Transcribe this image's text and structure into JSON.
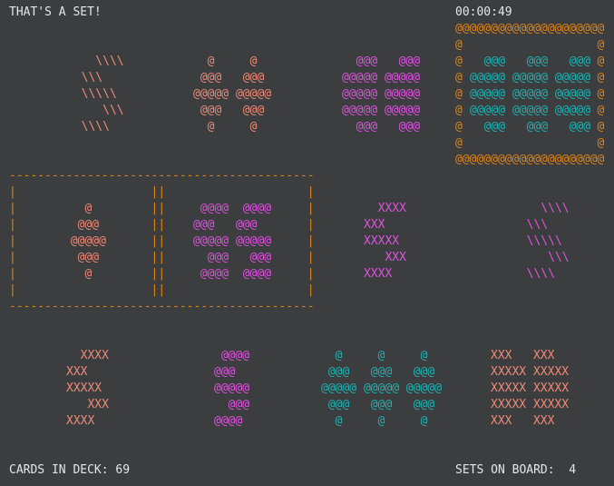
{
  "header": {
    "title": "THAT'S A SET!",
    "timer": "00:00:49"
  },
  "footer": {
    "deck_label": "CARDS IN DECK: 69",
    "sets_label": "SETS ON BOARD:  4"
  },
  "colors": {
    "salmon": "#f08a78",
    "magenta": "#e052e0",
    "teal": "#1fb3b3",
    "orange": "#e0851a",
    "background": "#3b3d3f",
    "text": "#e6e6e6"
  },
  "cards": [
    {
      "id": "r1c1",
      "color": "salmon",
      "art": "    \\\\\\\\\n  \\\\\\\n  \\\\\\\\\\\n     \\\\\\\n  \\\\\\\\"
    },
    {
      "id": "r1c2",
      "color": "salmon",
      "art": "  @     @\n @@@   @@@\n@@@@@ @@@@@\n @@@   @@@\n  @     @"
    },
    {
      "id": "r1c3",
      "color": "magenta",
      "art": "  @@@   @@@\n@@@@@ @@@@@\n@@@@@ @@@@@\n@@@@@ @@@@@\n  @@@   @@@"
    },
    {
      "id": "r1c4",
      "color": "teal",
      "art": "  @@@   @@@   @@@\n@@@@@ @@@@@ @@@@@\n@@@@@ @@@@@ @@@@@\n@@@@@ @@@@@ @@@@@\n  @@@   @@@   @@@"
    },
    {
      "id": "r2c1",
      "color": "salmon",
      "art": "   @\n  @@@\n @@@@@\n  @@@\n   @"
    },
    {
      "id": "r2c2",
      "color": "magenta",
      "art": " @@@@  @@@@\n@@@   @@@\n@@@@@ @@@@@\n  @@@   @@@\n @@@@  @@@@"
    },
    {
      "id": "r2c3",
      "color": "magenta",
      "art": "  XXXX\nXXX\nXXXXX\n   XXX\nXXXX"
    },
    {
      "id": "r2c4",
      "color": "magenta",
      "art": "    \\\\\\\\\n  \\\\\\\n  \\\\\\\\\\\n     \\\\\\\n  \\\\\\\\"
    },
    {
      "id": "r3c1",
      "color": "salmon",
      "art": "  XXXX\nXXX\nXXXXX\n   XXX\nXXXX"
    },
    {
      "id": "r3c2",
      "color": "magenta",
      "art": " @@@@\n@@@\n@@@@@\n  @@@\n@@@@"
    },
    {
      "id": "r3c3",
      "color": "teal",
      "art": "  @     @     @\n @@@   @@@   @@@\n@@@@@ @@@@@ @@@@@\n @@@   @@@   @@@\n  @     @     @"
    },
    {
      "id": "r3c4",
      "color": "salmon",
      "art": "XXX   XXX\nXXXXX XXXXX\nXXXXX XXXXX\nXXXXX XXXXX\nXXX   XXX"
    }
  ],
  "selection_box": {
    "color": "orange",
    "top": "-------------------------------------------",
    "row": "|                   ||                    |",
    "bottom": "-------------------------------------------"
  },
  "highlight_box": {
    "color": "orange",
    "top": "@@@@@@@@@@@@@@@@@@@@@",
    "side": "@                   @",
    "bottom": "@@@@@@@@@@@@@@@@@@@@@"
  }
}
